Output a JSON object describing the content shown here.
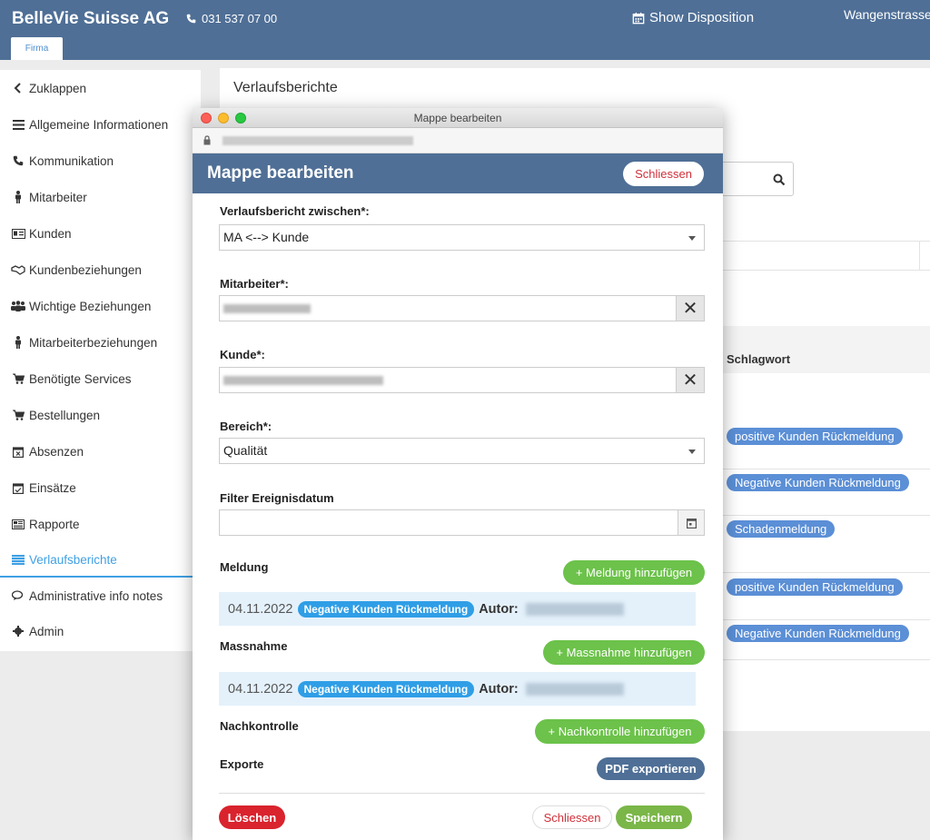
{
  "topbar": {
    "brand": "BelleVie Suisse AG",
    "phone": "031 537 07 00",
    "disposition": "Show Disposition",
    "street": "Wangenstrasse",
    "tab": "Firma",
    "color": "#4f6f96"
  },
  "sidebar": {
    "items": [
      {
        "label": "Zuklappen",
        "icon": "chevron-left-icon"
      },
      {
        "label": "Allgemeine Informationen",
        "icon": "list-icon"
      },
      {
        "label": "Kommunikation",
        "icon": "phone-icon"
      },
      {
        "label": "Mitarbeiter",
        "icon": "person-icon"
      },
      {
        "label": "Kunden",
        "icon": "id-card-icon"
      },
      {
        "label": "Kundenbeziehungen",
        "icon": "handshake-icon"
      },
      {
        "label": "Wichtige Beziehungen",
        "icon": "users-icon"
      },
      {
        "label": "Mitarbeiterbeziehungen",
        "icon": "person-icon"
      },
      {
        "label": "Benötigte Services",
        "icon": "cart-icon"
      },
      {
        "label": "Bestellungen",
        "icon": "cart-icon"
      },
      {
        "label": "Absenzen",
        "icon": "calendar-x-icon"
      },
      {
        "label": "Einsätze",
        "icon": "calendar-check-icon"
      },
      {
        "label": "Rapporte",
        "icon": "newspaper-icon"
      },
      {
        "label": "Verlaufsberichte",
        "icon": "list-alt-icon"
      },
      {
        "label": "Administrative info notes",
        "icon": "comments-icon"
      },
      {
        "label": "Admin",
        "icon": "gear-icon"
      }
    ],
    "active_index": 13,
    "active_color": "#3fa0e3"
  },
  "main": {
    "title": "Verlaufsberichte",
    "column_schlagwort": "Schlagwort",
    "tags": [
      "positive Kunden Rückmeldung",
      "Negative Kunden Rückmeldung",
      "Schadenmeldung",
      "positive Kunden Rückmeldung",
      "Negative Kunden Rückmeldung"
    ]
  },
  "window": {
    "title": "Mappe bearbeiten"
  },
  "modal": {
    "title": "Mappe bearbeiten",
    "close_label": "Schliessen",
    "verlauf_label": "Verlaufsbericht zwischen*:",
    "verlauf_value": "MA <--> Kunde",
    "mitarbeiter_label": "Mitarbeiter*:",
    "kunde_label": "Kunde*:",
    "bereich_label": "Bereich*:",
    "bereich_value": "Qualität",
    "filter_label": "Filter Ereignisdatum",
    "filter_value": "",
    "meldung_label": "Meldung",
    "meldung_add": "+ Meldung hinzufügen",
    "meldung_entry": {
      "date": "04.11.2022",
      "tag": "Negative Kunden Rückmeldung",
      "autor": "Autor:"
    },
    "massnahme_label": "Massnahme",
    "massnahme_add": "+ Massnahme hinzufügen",
    "massnahme_entry": {
      "date": "04.11.2022",
      "tag": "Negative Kunden Rückmeldung",
      "autor": "Autor:"
    },
    "nachkontrolle_label": "Nachkontrolle",
    "nachkontrolle_add": "+ Nachkontrolle hinzufügen",
    "exporte_label": "Exporte",
    "pdf_label": "PDF exportieren",
    "delete_label": "Löschen",
    "close2_label": "Schliessen",
    "save_label": "Speichern"
  }
}
